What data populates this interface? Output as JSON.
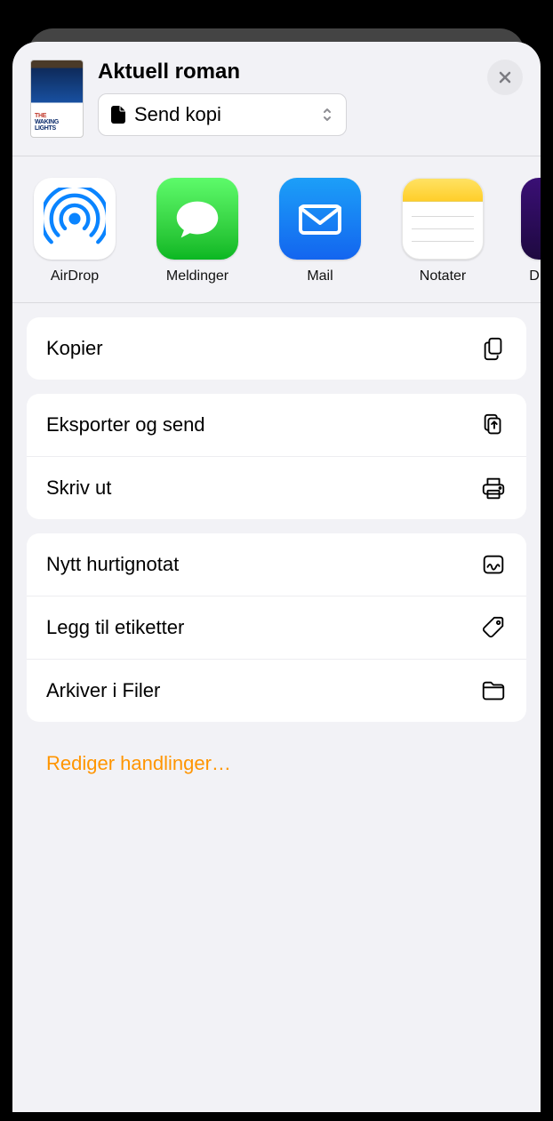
{
  "header": {
    "title": "Aktuell roman",
    "dropdown_label": "Send kopi",
    "thumb_title_html": "THE<br>WAKING<br>LIGHTS"
  },
  "apps": [
    {
      "id": "airdrop",
      "label": "AirDrop"
    },
    {
      "id": "messages",
      "label": "Meldinger"
    },
    {
      "id": "mail",
      "label": "Mail"
    },
    {
      "id": "notes",
      "label": "Notater"
    },
    {
      "id": "next",
      "label": "D"
    }
  ],
  "groups": [
    {
      "actions": [
        {
          "id": "copy",
          "label": "Kopier"
        }
      ]
    },
    {
      "actions": [
        {
          "id": "export",
          "label": "Eksporter og send"
        },
        {
          "id": "print",
          "label": "Skriv ut"
        }
      ]
    },
    {
      "actions": [
        {
          "id": "quicknote",
          "label": "Nytt hurtignotat"
        },
        {
          "id": "tags",
          "label": "Legg til etiketter"
        },
        {
          "id": "files",
          "label": "Arkiver i Filer"
        }
      ]
    }
  ],
  "edit_label": "Rediger handlinger…",
  "colors": {
    "accent": "#ff9500"
  }
}
